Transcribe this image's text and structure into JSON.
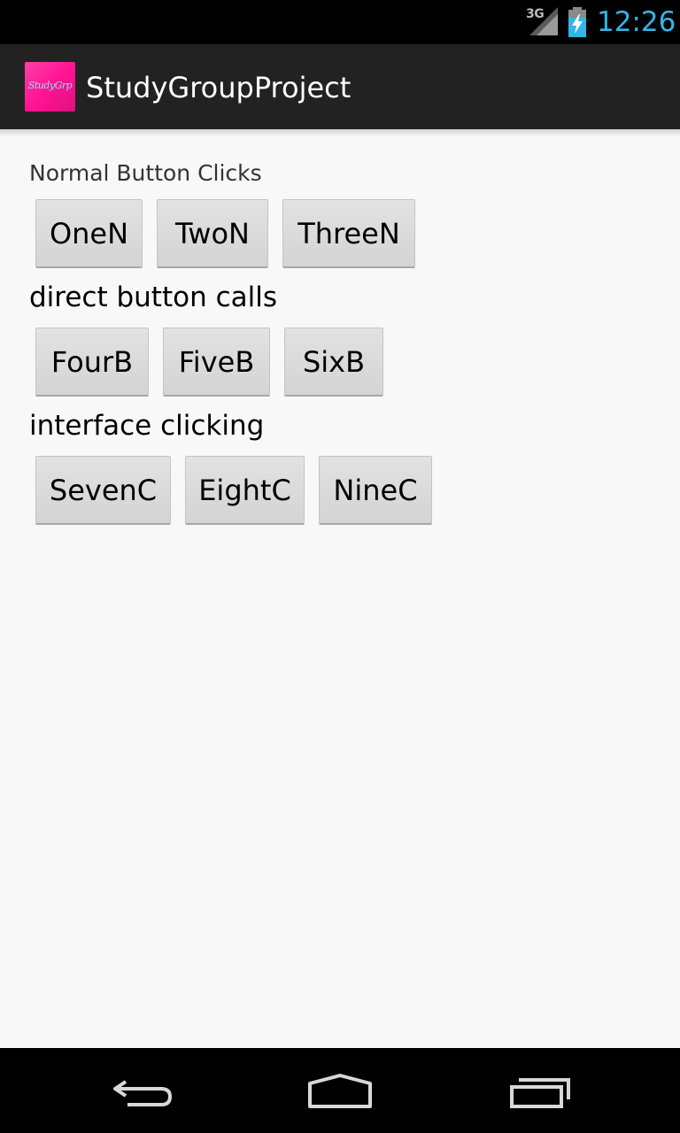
{
  "status_bar": {
    "network_type": "3G",
    "time": "12:26",
    "icons": [
      "signal-icon",
      "battery-charging-icon"
    ]
  },
  "action_bar": {
    "app_icon_text": "StudyGrp",
    "title": "StudyGroupProject"
  },
  "sections": [
    {
      "label": "Normal Button Clicks",
      "buttons": [
        "OneN",
        "TwoN",
        "ThreeN"
      ]
    },
    {
      "label": "direct button calls",
      "buttons": [
        "FourB",
        "FiveB",
        "SixB"
      ]
    },
    {
      "label": "interface clicking",
      "buttons": [
        "SevenC",
        "EightC",
        "NineC"
      ]
    }
  ],
  "nav_bar": {
    "icons": [
      "back-icon",
      "home-icon",
      "recent-apps-icon"
    ]
  },
  "colors": {
    "status_bar_bg": "#000000",
    "clock": "#33b5e5",
    "action_bar_bg": "#222222",
    "app_icon": "#ff1493",
    "content_bg": "#f8f8f8",
    "button_bg": "#d8d8d8",
    "nav_bar_bg": "#000000"
  }
}
